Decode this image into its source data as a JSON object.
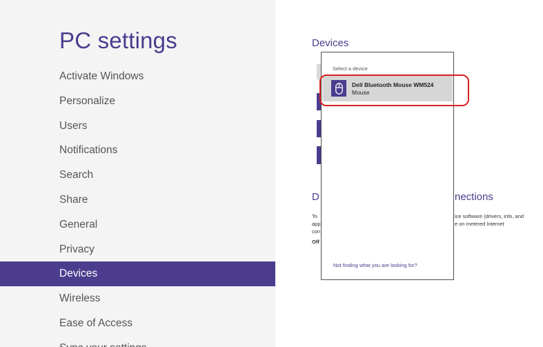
{
  "left": {
    "title": "PC settings",
    "nav": [
      {
        "label": "Activate Windows"
      },
      {
        "label": "Personalize"
      },
      {
        "label": "Users"
      },
      {
        "label": "Notifications"
      },
      {
        "label": "Search"
      },
      {
        "label": "Share"
      },
      {
        "label": "General"
      },
      {
        "label": "Privacy"
      },
      {
        "label": "Devices",
        "selected": true
      },
      {
        "label": "Wireless"
      },
      {
        "label": "Ease of Access"
      },
      {
        "label": "Sync your settings"
      }
    ]
  },
  "right": {
    "heading": "Devices",
    "section2_heading_left": "D",
    "section2_heading_right": "nections",
    "text_left_1": "To",
    "text_left_2": "app",
    "text_left_3": "con",
    "text_left_bold": "Off",
    "text_right_1": "ice software (drivers, info, and",
    "text_right_2": "e on metered Internet"
  },
  "flyout": {
    "caption": "Select a device",
    "device": {
      "name": "Dell Bluetooth Mouse WM524",
      "type": "Mouse",
      "icon": "mouse-icon"
    },
    "link": "Not finding what you are looking for?"
  },
  "colors": {
    "accent": "#4b3c8e",
    "highlight": "#d9201f"
  }
}
